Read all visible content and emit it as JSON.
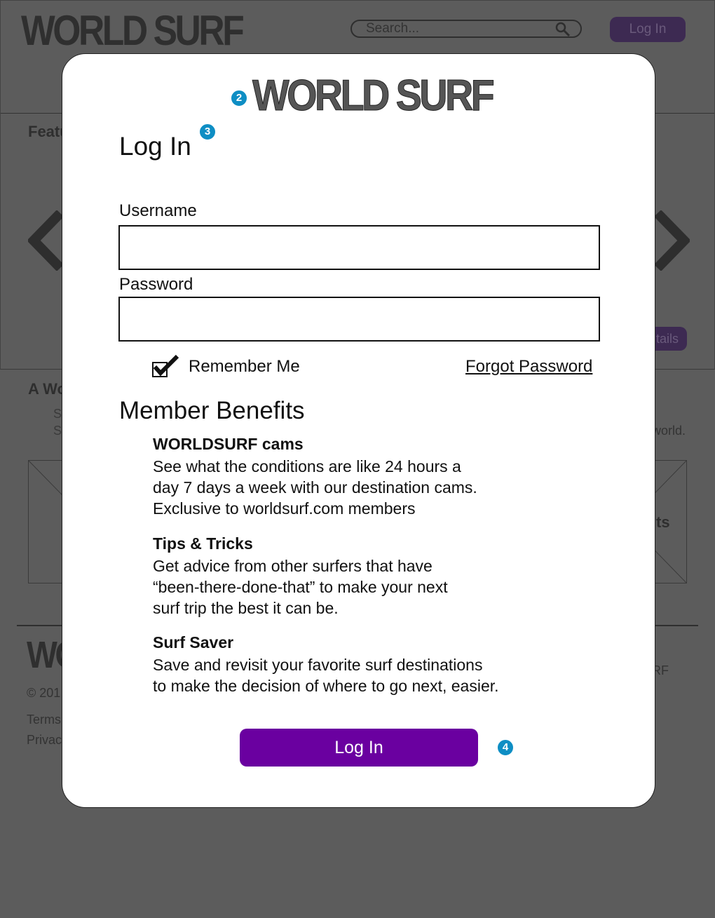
{
  "background": {
    "logo": "WORLD SURF",
    "search_placeholder": "Search...",
    "login_label": "Log In",
    "featured_fragment": "Featu",
    "details_fragment": "tails",
    "section_fragment": "A Wor",
    "s_line1": "S",
    "s_line2": "S",
    "world_fragment": "world.",
    "ts_fragment": "ts",
    "footer_logo": "WO",
    "copyright_fragment": "© 201",
    "terms_fragment": "Terms",
    "privacy_fragment": "Privac",
    "rf_fragment": "RF"
  },
  "modal": {
    "logo": "WORLD SURF",
    "title": "Log In",
    "username_label": "Username",
    "password_label": "Password",
    "remember_label": "Remember Me",
    "remember_checked": true,
    "forgot_label": "Forgot Password",
    "benefits_title": "Member Benefits",
    "benefits": [
      {
        "title": "WORLDSURF cams",
        "lines": [
          "See what the conditions are like 24 hours a",
          "day 7 days a week with our destination cams.",
          "Exclusive to worldsurf.com members"
        ]
      },
      {
        "title": "Tips & Tricks",
        "lines": [
          "Get advice from other surfers that have",
          "“been-there-done-that” to make your next",
          "surf trip the best it can be."
        ]
      },
      {
        "title": "Surf Saver",
        "lines": [
          "Save and revisit your favorite surf destinations",
          "to make the decision of where to go next, easier."
        ]
      }
    ],
    "login_button": "Log In"
  },
  "annotations": {
    "marker_2": "2",
    "marker_3": "3",
    "marker_4": "4"
  },
  "colors": {
    "overlay": "#5c5c5c",
    "accent_purple": "#6a00a0",
    "annotation_blue": "#0e8ec4"
  }
}
